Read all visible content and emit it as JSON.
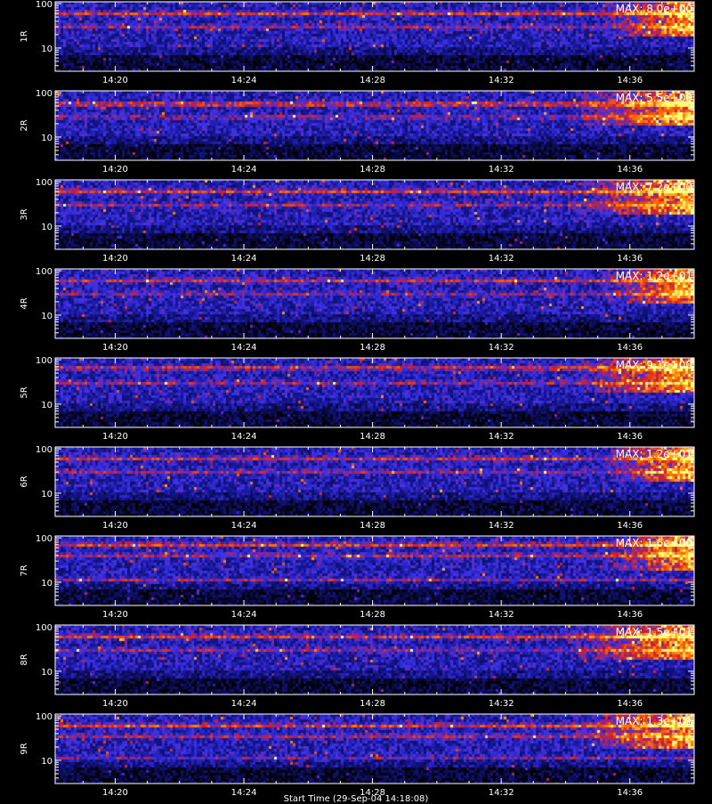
{
  "figure": {
    "type": "stacked-spectrograms",
    "x_label": "Start Time (29-Sep-04 14:18:08)"
  },
  "chart_data": [
    {
      "type": "heatmap",
      "ylabel": "1R",
      "max_label": "MAX: 8.0e+00",
      "max_value": 8.0,
      "x_ticks": [
        "14:20",
        "14:24",
        "14:28",
        "14:32",
        "14:36"
      ],
      "y_ticks": [
        "100",
        "10"
      ],
      "ylog": true,
      "ylim": [
        3,
        110
      ],
      "xlim": [
        "14:18:08",
        "14:38:00"
      ],
      "colormap": "black-blue-red-yellow",
      "features": [
        {
          "type": "band",
          "center": 60,
          "strength": 0.7
        },
        {
          "type": "band",
          "center": 30,
          "strength": 0.45
        }
      ],
      "intensification_after": "14:35"
    },
    {
      "type": "heatmap",
      "ylabel": "2R",
      "max_label": "MAX: 5.5e+00",
      "max_value": 5.5,
      "x_ticks": [
        "14:20",
        "14:24",
        "14:28",
        "14:32",
        "14:36"
      ],
      "y_ticks": [
        "100",
        "10"
      ],
      "ylog": true,
      "ylim": [
        3,
        110
      ],
      "xlim": [
        "14:18:08",
        "14:38:00"
      ],
      "colormap": "black-blue-red-yellow",
      "features": [
        {
          "type": "band",
          "center": 55,
          "strength": 0.8
        },
        {
          "type": "band",
          "center": 28,
          "strength": 0.4
        }
      ],
      "intensification_after": "14:34"
    },
    {
      "type": "heatmap",
      "ylabel": "3R",
      "max_label": "MAX: 7.2e+00",
      "max_value": 7.2,
      "x_ticks": [
        "14:20",
        "14:24",
        "14:28",
        "14:32",
        "14:36"
      ],
      "y_ticks": [
        "100",
        "10"
      ],
      "ylog": true,
      "ylim": [
        3,
        110
      ],
      "xlim": [
        "14:18:08",
        "14:38:00"
      ],
      "colormap": "black-blue-red-yellow",
      "features": [
        {
          "type": "band",
          "center": 60,
          "strength": 0.7
        },
        {
          "type": "band",
          "center": 30,
          "strength": 0.45
        }
      ],
      "intensification_after": "14:34"
    },
    {
      "type": "heatmap",
      "ylabel": "4R",
      "max_label": "MAX: 1.2e+01",
      "max_value": 12,
      "x_ticks": [
        "14:20",
        "14:24",
        "14:28",
        "14:32",
        "14:36"
      ],
      "y_ticks": [
        "100",
        "10"
      ],
      "ylog": true,
      "ylim": [
        3,
        110
      ],
      "xlim": [
        "14:18:08",
        "14:38:00"
      ],
      "colormap": "black-blue-red-yellow",
      "features": [
        {
          "type": "band",
          "center": 60,
          "strength": 0.6
        },
        {
          "type": "band",
          "center": 30,
          "strength": 0.4
        }
      ],
      "intensification_after": "14:35"
    },
    {
      "type": "heatmap",
      "ylabel": "5R",
      "max_label": "MAX: 9.1e+00",
      "max_value": 9.1,
      "x_ticks": [
        "14:20",
        "14:24",
        "14:28",
        "14:32",
        "14:36"
      ],
      "y_ticks": [
        "100",
        "10"
      ],
      "ylog": true,
      "ylim": [
        3,
        110
      ],
      "xlim": [
        "14:18:08",
        "14:38:00"
      ],
      "colormap": "black-blue-red-yellow",
      "features": [
        {
          "type": "band",
          "center": 65,
          "strength": 0.65
        },
        {
          "type": "band",
          "center": 30,
          "strength": 0.45
        }
      ],
      "intensification_after": "14:34"
    },
    {
      "type": "heatmap",
      "ylabel": "6R",
      "max_label": "MAX: 1.2e+01",
      "max_value": 12,
      "x_ticks": [
        "14:20",
        "14:24",
        "14:28",
        "14:32",
        "14:36"
      ],
      "y_ticks": [
        "100",
        "10"
      ],
      "ylog": true,
      "ylim": [
        3,
        110
      ],
      "xlim": [
        "14:18:08",
        "14:38:00"
      ],
      "colormap": "black-blue-red-yellow",
      "features": [
        {
          "type": "band",
          "center": 60,
          "strength": 0.6
        },
        {
          "type": "band",
          "center": 30,
          "strength": 0.45
        }
      ],
      "intensification_after": "14:35"
    },
    {
      "type": "heatmap",
      "ylabel": "7R",
      "max_label": "MAX: 1.6e+00",
      "max_value": 1.6,
      "x_ticks": [
        "14:20",
        "14:24",
        "14:28",
        "14:32",
        "14:36"
      ],
      "y_ticks": [
        "100",
        "10"
      ],
      "ylog": true,
      "ylim": [
        3,
        110
      ],
      "xlim": [
        "14:18:08",
        "14:38:00"
      ],
      "colormap": "black-blue-red-yellow",
      "features": [
        {
          "type": "band",
          "center": 70,
          "strength": 0.7
        },
        {
          "type": "band",
          "center": 40,
          "strength": 0.5
        },
        {
          "type": "band",
          "center": 11,
          "strength": 0.45
        }
      ],
      "intensification_after": "14:35"
    },
    {
      "type": "heatmap",
      "ylabel": "8R",
      "max_label": "MAX: 1.5e+01",
      "max_value": 15,
      "x_ticks": [
        "14:20",
        "14:24",
        "14:28",
        "14:32",
        "14:36"
      ],
      "y_ticks": [
        "100",
        "10"
      ],
      "ylog": true,
      "ylim": [
        3,
        110
      ],
      "xlim": [
        "14:18:08",
        "14:38:00"
      ],
      "colormap": "black-blue-red-yellow",
      "features": [
        {
          "type": "band",
          "center": 60,
          "strength": 0.65
        },
        {
          "type": "band",
          "center": 30,
          "strength": 0.45
        }
      ],
      "intensification_after": "14:34"
    },
    {
      "type": "heatmap",
      "ylabel": "9R",
      "max_label": "MAX: 1.3e+01",
      "max_value": 13,
      "x_ticks": [
        "14:20",
        "14:24",
        "14:28",
        "14:32",
        "14:36"
      ],
      "y_ticks": [
        "100",
        "10"
      ],
      "ylog": true,
      "ylim": [
        3,
        110
      ],
      "xlim": [
        "14:18:08",
        "14:38:00"
      ],
      "colormap": "black-blue-red-yellow",
      "features": [
        {
          "type": "band",
          "center": 60,
          "strength": 0.7
        },
        {
          "type": "band",
          "center": 35,
          "strength": 0.5
        },
        {
          "type": "band",
          "center": 11,
          "strength": 0.35
        }
      ],
      "intensification_after": "14:34"
    }
  ]
}
